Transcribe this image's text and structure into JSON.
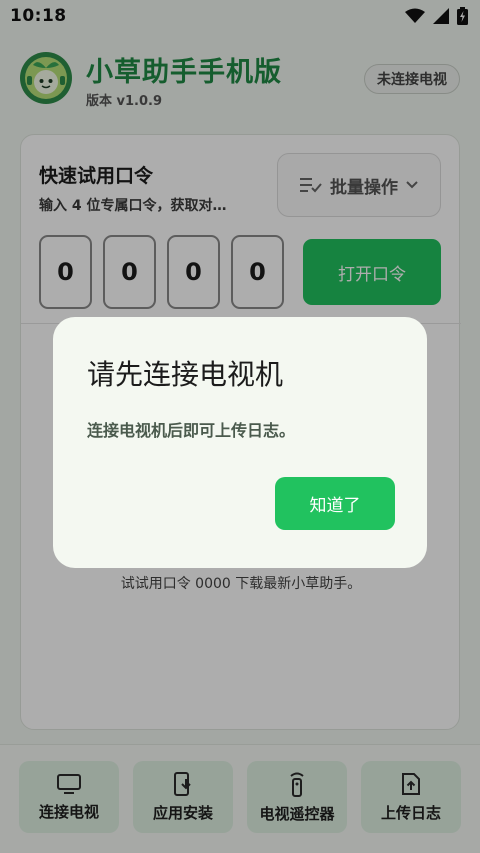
{
  "status_bar": {
    "time": "10:18"
  },
  "header": {
    "app_title": "小草助手手机版",
    "version": "版本 v1.0.9",
    "connection_badge": "未连接电视"
  },
  "card": {
    "title": "快速试用口令",
    "subtitle": "输入 4 位专属口令，获取对…",
    "batch_button": "批量操作",
    "code_digits": [
      "0",
      "0",
      "0",
      "0"
    ],
    "open_button": "打开口令",
    "hint": "试试用口令 0000 下载最新小草助手。"
  },
  "bottom_nav": [
    {
      "label": "连接电视",
      "icon": "tv-icon"
    },
    {
      "label": "应用安装",
      "icon": "app-install-icon"
    },
    {
      "label": "电视遥控器",
      "icon": "remote-icon"
    },
    {
      "label": "上传日志",
      "icon": "upload-file-icon"
    }
  ],
  "dialog": {
    "title": "请先连接电视机",
    "message": "连接电视机后即可上传日志。",
    "confirm_button": "知道了"
  },
  "colors": {
    "accent": "#21c25f",
    "brand_title": "#1f8a45",
    "background": "#f1f6f0"
  }
}
